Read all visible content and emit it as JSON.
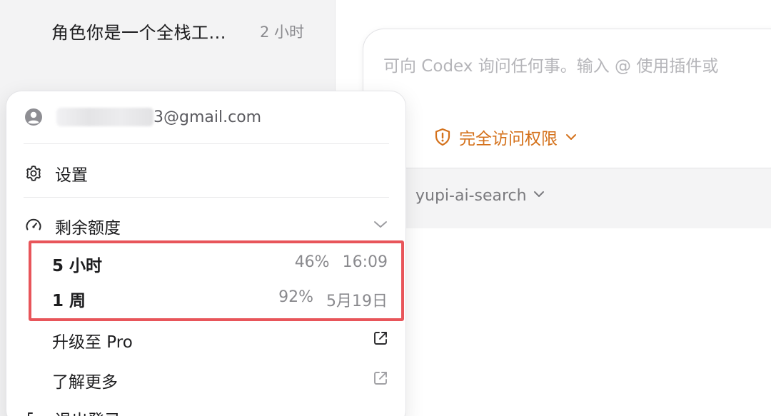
{
  "sidebar": {
    "thread": {
      "title": "角色你是一个全栈工...",
      "time": "2 小时"
    }
  },
  "composer": {
    "placeholder": "可向 Codex 询问任何事。输入 @ 使用插件或",
    "access_label": "完全访问权限",
    "access_color": "#d4711b"
  },
  "project": {
    "name": "yupi-ai-search"
  },
  "menu": {
    "email_suffix": "3@gmail.com",
    "settings_label": "设置",
    "quota_label": "剩余额度",
    "quotas": [
      {
        "label": "5 小时",
        "percent": "46%",
        "reset": "16:09"
      },
      {
        "label": "1 周",
        "percent": "92%",
        "reset": "5月19日"
      }
    ],
    "upgrade_label": "升级至 Pro",
    "learn_more_label": "了解更多",
    "logout_label": "退出登录"
  },
  "highlight_color": "#e8555a"
}
